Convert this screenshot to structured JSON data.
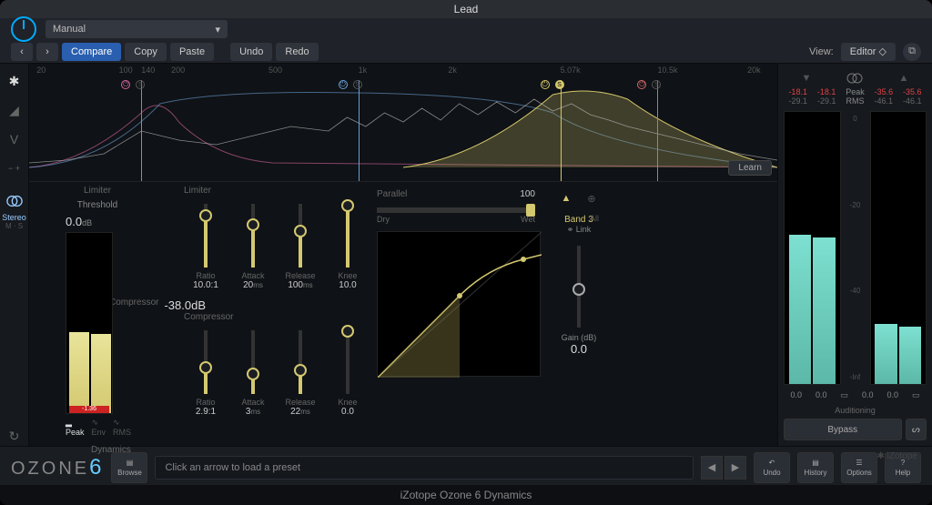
{
  "window_title": "Lead",
  "footer_text": "iZotope Ozone 6 Dynamics",
  "preset_dropdown": "Manual",
  "toolbar": {
    "prev": "‹",
    "next": "›",
    "compare": "Compare",
    "copy": "Copy",
    "paste": "Paste",
    "undo": "Undo",
    "redo": "Redo",
    "view_label": "View:",
    "view_value": "Editor"
  },
  "spectrum": {
    "freq_ticks": [
      {
        "label": "20",
        "pct": 1
      },
      {
        "label": "100",
        "pct": 12
      },
      {
        "label": "140",
        "pct": 15
      },
      {
        "label": "200",
        "pct": 19
      },
      {
        "label": "500",
        "pct": 32
      },
      {
        "label": "1k",
        "pct": 44
      },
      {
        "label": "2k",
        "pct": 56
      },
      {
        "label": "5.07k",
        "pct": 71
      },
      {
        "label": "10.5k",
        "pct": 84
      },
      {
        "label": "20k",
        "pct": 96
      }
    ],
    "bands": [
      {
        "pos": 15,
        "color": "#d466a0",
        "active": false
      },
      {
        "pos": 44,
        "color": "#6a9fd4",
        "active": false
      },
      {
        "pos": 71,
        "color": "#d4c76a",
        "active": true
      },
      {
        "pos": 84,
        "color": "#d46a6a",
        "active": false
      }
    ],
    "learn": "Learn"
  },
  "stereo_mode": {
    "label": "Stereo",
    "ms": "M · S"
  },
  "limiter": {
    "title": "Limiter",
    "threshold_label": "Threshold",
    "threshold": "0.0",
    "threshold_unit": "dB",
    "ratio": {
      "label": "Ratio",
      "value": "10.0:1"
    },
    "attack": {
      "label": "Attack",
      "value": "20",
      "unit": "ms"
    },
    "release": {
      "label": "Release",
      "value": "100",
      "unit": "ms"
    },
    "knee": {
      "label": "Knee",
      "value": "10.0"
    },
    "meter_clip": "-1.36"
  },
  "compressor": {
    "title": "Compressor",
    "threshold": "-38.0",
    "threshold_unit": "dB",
    "ratio": {
      "label": "Ratio",
      "value": "2.9:1"
    },
    "attack": {
      "label": "Attack",
      "value": "3",
      "unit": "ms"
    },
    "release": {
      "label": "Release",
      "value": "22",
      "unit": "ms"
    },
    "knee": {
      "label": "Knee",
      "value": "0.0"
    }
  },
  "detection": {
    "peak": "Peak",
    "env": "Env",
    "rms": "RMS"
  },
  "parallel": {
    "title": "Parallel",
    "value": "100",
    "dry": "Dry",
    "wet": "Wet"
  },
  "band_select": {
    "band": "Band 3",
    "all": "All",
    "link": "Link"
  },
  "gain": {
    "label": "Gain (dB)",
    "value": "0.0"
  },
  "bottom": {
    "logo": "OZONE",
    "logo_num": "6",
    "logo_sub": "Dynamics",
    "browse": "Browse",
    "preset_hint": "Click an arrow to load a preset",
    "undo": "Undo",
    "history": "History",
    "options": "Options",
    "help": "Help"
  },
  "meters": {
    "peak_label": "Peak",
    "rms_label": "RMS",
    "in_peak_l": "-18.1",
    "in_peak_r": "-18.1",
    "in_rms_l": "-29.1",
    "in_rms_r": "-29.1",
    "out_peak_l": "-35.6",
    "out_peak_r": "-35.6",
    "out_rms_l": "-46.1",
    "out_rms_r": "-46.1",
    "scale": [
      "0",
      "-20",
      "-40",
      "-Inf"
    ],
    "foot_l": "0.0",
    "foot_r": "0.0",
    "auditioning": "Auditioning",
    "bypass": "Bypass"
  },
  "brand": "iZotope"
}
